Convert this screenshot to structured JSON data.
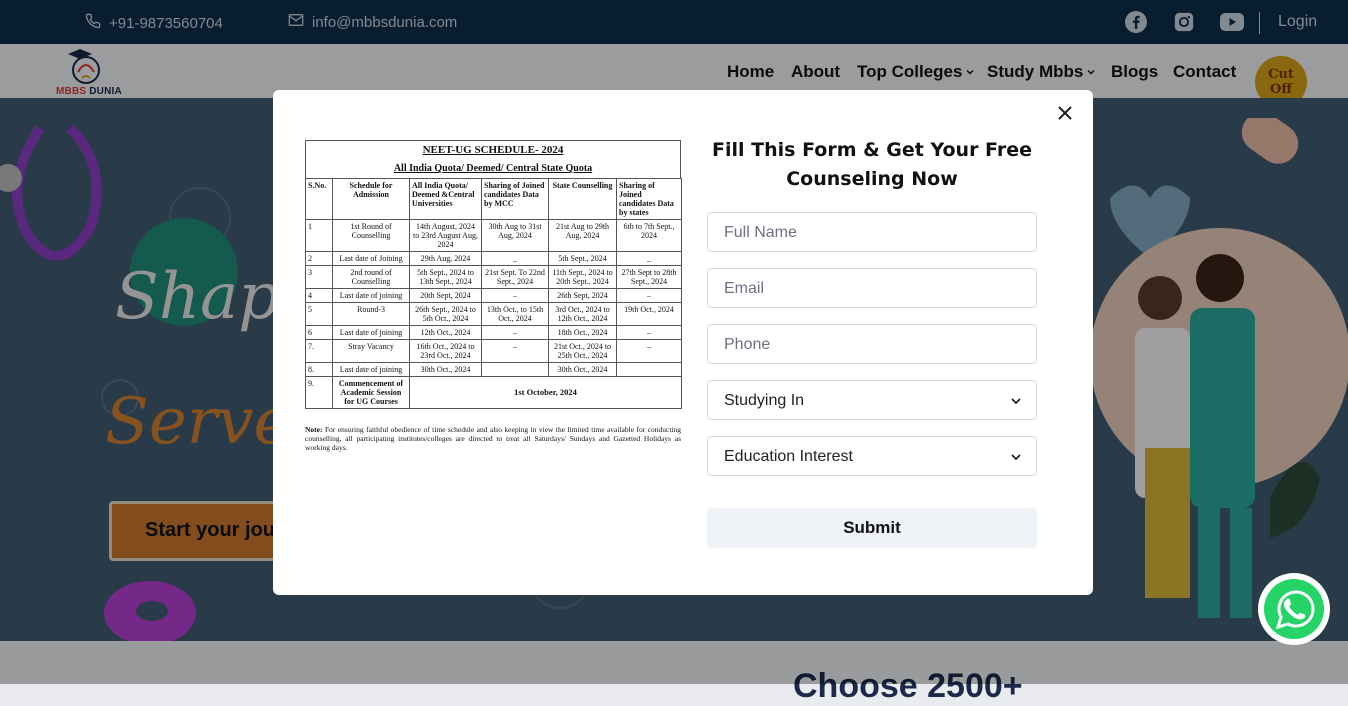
{
  "topbar": {
    "phone": "+91-9873560704",
    "email": "info@mbbsdunia.com",
    "login": "Login",
    "social_icons": [
      "facebook-icon",
      "instagram-icon",
      "youtube-icon"
    ]
  },
  "logo": {
    "text_red": "MBBS",
    "text_dark": "DUNIA"
  },
  "nav": {
    "home": "Home",
    "about": "About",
    "top_colleges": "Top Colleges",
    "study_mbbs": "Study Mbbs",
    "blogs": "Blogs",
    "contact": "Contact",
    "badge": "Cut Off"
  },
  "hero": {
    "line1": "Shape",
    "line2": "Serve y",
    "cta": "Start your jou"
  },
  "bottom": {
    "heading": "Choose 2500+"
  },
  "modal": {
    "schedule": {
      "title": "NEET-UG SCHEDULE- 2024",
      "subtitle": "All India Quota/ Deemed/ Central State Quota",
      "headers": {
        "sno": "S.No.",
        "schedule": "Schedule for Admission",
        "aiq": "All India Quota/ Deemed &Central Universities",
        "aiq_sharing": "Sharing of Joined candidates Data by MCC",
        "state": "State Counselling",
        "state_sharing": "Sharing of Joined candidates Data by states"
      },
      "rows": [
        [
          "1",
          "1st Round of Counselling",
          "14th August, 2024 to 23rd August Aug, 2024",
          "30th Aug to 31st Aug, 2024",
          "21st Aug to 29th Aug, 2024",
          "6th to 7th Sept., 2024"
        ],
        [
          "2",
          "Last date of Joining",
          "29th Aug, 2024",
          "_",
          "5th Sept., 2024",
          "_"
        ],
        [
          "3",
          "2nd round of Counselling",
          "5th Sept., 2024 to 13th Sept., 2024",
          "21st Sept. To 22nd Sept., 2024",
          "11th Sept., 2024 to 20th Sept., 2024",
          "27th Sept to 28th Sept., 2024"
        ],
        [
          "4",
          "Last date of joining",
          "20th Sept, 2024",
          "–",
          "26th Sept, 2024",
          "–"
        ],
        [
          "5",
          "Round-3",
          "26th Sept., 2024 to 5th Oct., 2024",
          "13th Oct., to 15th Oct., 2024",
          "3rd Oct., 2024 to 12th Oct., 2024",
          "19th Oct., 2024"
        ],
        [
          "6",
          "Last date of joining",
          "12th Oct., 2024",
          "–",
          "18th Oct., 2024",
          "–"
        ],
        [
          "7.",
          "Stray Vacancy",
          "16th Oct., 2024 to 23rd Oct., 2024",
          "–",
          "21st Oct., 2024 to 25th Oct., 2024",
          "–"
        ],
        [
          "8.",
          "Last date of joining",
          "30th Oct., 2024",
          "",
          "30th Oct., 2024",
          ""
        ]
      ],
      "row9": {
        "sno": "9.",
        "label": "Commencement of Academic Session for UG Courses",
        "date": "1st October, 2024"
      },
      "note_label": "Note:",
      "note": "For ensuring faithful obedience of time schedule and also keeping in view the limited time available for conducting counselling, all participating institutes/colleges are directed to treat all Saturdays/ Sundays and Gazetted Holidays as working days."
    },
    "form": {
      "title": "Fill This Form & Get Your Free Counseling Now",
      "full_name_placeholder": "Full Name",
      "email_placeholder": "Email",
      "phone_placeholder": "Phone",
      "studying_in": "Studying In",
      "education_interest": "Education Interest",
      "submit": "Submit"
    }
  },
  "colors": {
    "topbar_bg": "#0d2d4a",
    "hero_bg": "#3f5b6f",
    "accent_orange": "#c9762b",
    "whatsapp_green": "#25d366"
  }
}
